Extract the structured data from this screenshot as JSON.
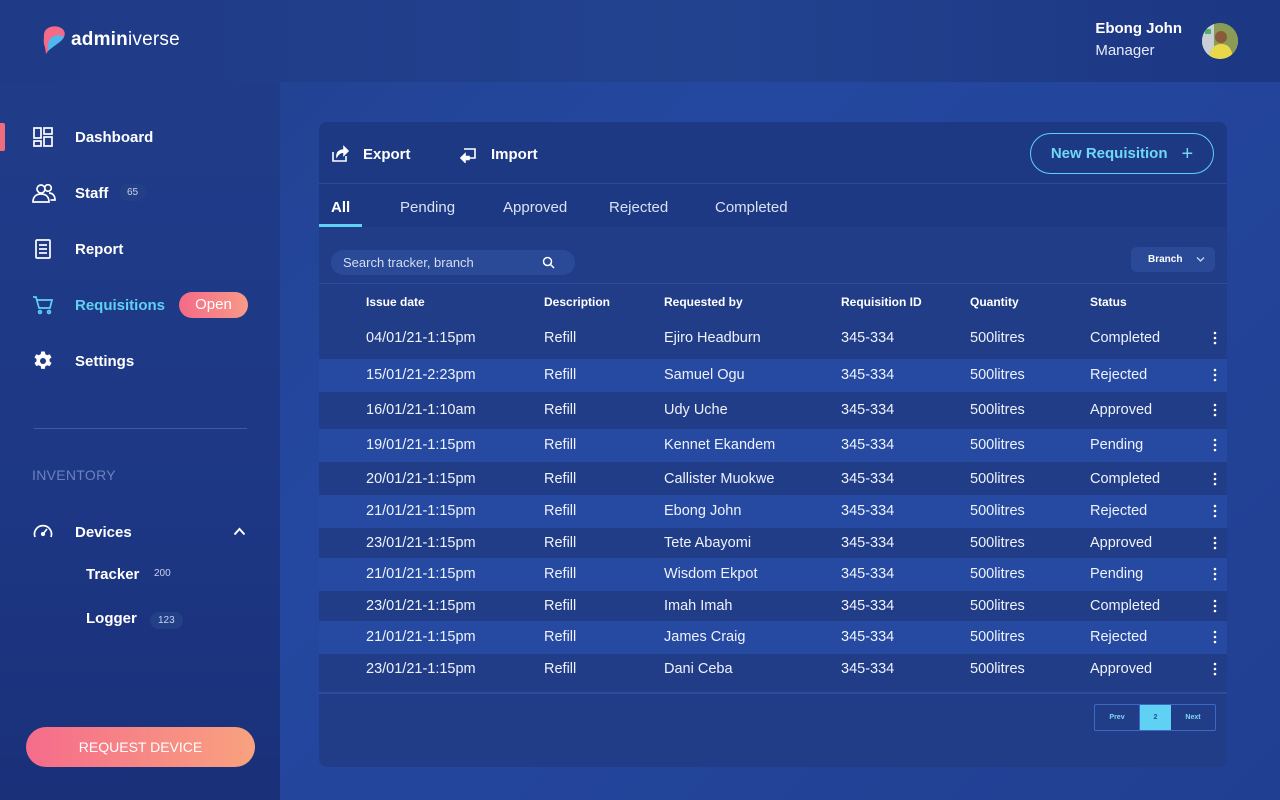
{
  "brand": {
    "logo_bold": "admin",
    "logo_rest": "iverse"
  },
  "user": {
    "name": "Ebong John",
    "role": "Manager"
  },
  "colors": {
    "accent": "#5fd1f2",
    "pink": "#f56a87",
    "peach": "#f8a27f"
  },
  "sidebar": {
    "items": [
      {
        "label": "Dashboard",
        "icon": "dashboard-icon"
      },
      {
        "label": "Staff",
        "icon": "staff-icon",
        "count": "65"
      },
      {
        "label": "Report",
        "icon": "report-icon"
      },
      {
        "label": "Requisitions",
        "icon": "cart-icon",
        "pill": "Open"
      },
      {
        "label": "Settings",
        "icon": "gear-icon"
      }
    ],
    "inventory_title": "INVENTORY",
    "devices": {
      "label": "Devices",
      "icon": "gauge-icon"
    },
    "sub_items": [
      {
        "label": "Tracker",
        "count": "200"
      },
      {
        "label": "Logger",
        "count": "123"
      }
    ],
    "request_button": "REQUEST DEVICE"
  },
  "toolbar": {
    "export_label": "Export",
    "import_label": "Import",
    "new_requisition_label": "New Requisition",
    "new_requisition_plus": "+"
  },
  "tabs": [
    "All",
    "Pending",
    "Approved",
    "Rejected",
    "Completed"
  ],
  "search": {
    "placeholder": "Search tracker, branch"
  },
  "filter": {
    "branch_label": "Branch"
  },
  "table": {
    "headers": [
      "Issue date",
      "Description",
      "Requested by",
      "Requisition ID",
      "Quantity",
      "Status"
    ],
    "rows": [
      [
        "04/01/21-1:15pm",
        "Refill",
        "Ejiro Headburn",
        "345-334",
        "500litres",
        "Completed"
      ],
      [
        "15/01/21-2:23pm",
        "Refill",
        "Samuel Ogu",
        "345-334",
        "500litres",
        "Rejected"
      ],
      [
        "16/01/21-1:10am",
        "Refill",
        "Udy Uche",
        "345-334",
        "500litres",
        "Approved"
      ],
      [
        "19/01/21-1:15pm",
        "Refill",
        "Kennet Ekandem",
        "345-334",
        "500litres",
        "Pending"
      ],
      [
        "20/01/21-1:15pm",
        "Refill",
        "Callister Muokwe",
        "345-334",
        "500litres",
        "Completed"
      ],
      [
        "21/01/21-1:15pm",
        "Refill",
        "Ebong John",
        "345-334",
        "500litres",
        "Rejected"
      ],
      [
        "23/01/21-1:15pm",
        "Refill",
        "Tete Abayomi",
        "345-334",
        "500litres",
        "Approved"
      ],
      [
        "21/01/21-1:15pm",
        "Refill",
        "Wisdom Ekpot",
        "345-334",
        "500litres",
        "Pending"
      ],
      [
        "23/01/21-1:15pm",
        "Refill",
        "Imah Imah",
        "345-334",
        "500litres",
        "Completed"
      ],
      [
        "21/01/21-1:15pm",
        "Refill",
        "James Craig",
        "345-334",
        "500litres",
        "Rejected"
      ],
      [
        "23/01/21-1:15pm",
        "Refill",
        "Dani Ceba",
        "345-334",
        "500litres",
        "Approved"
      ]
    ]
  },
  "pagination": {
    "prev": "Prev",
    "current": "2",
    "next": "Next"
  }
}
